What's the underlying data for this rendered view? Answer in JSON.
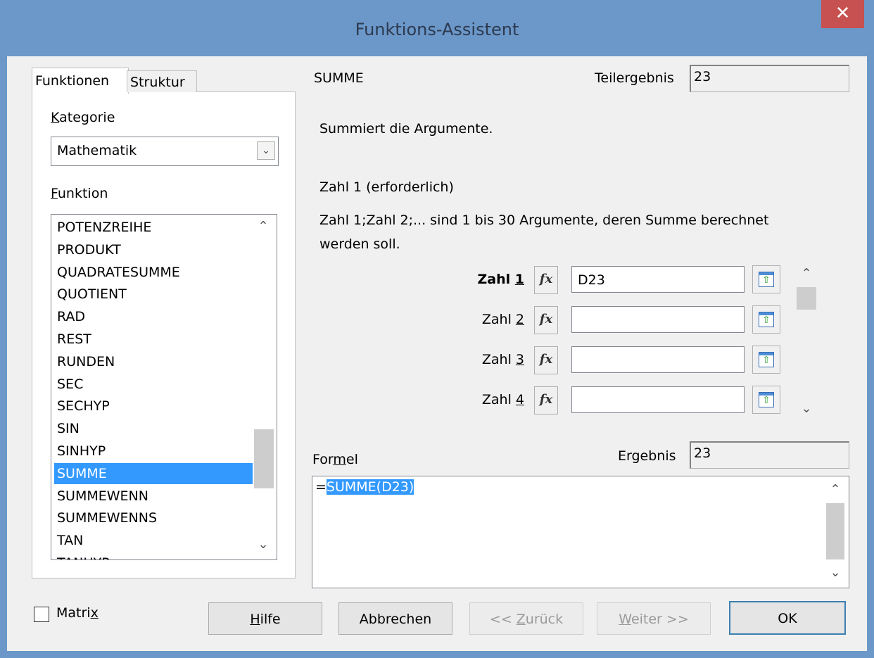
{
  "window": {
    "title": "Funktions-Assistent",
    "close_glyph": "✕"
  },
  "tabs": [
    {
      "label": "Funktionen",
      "active": true
    },
    {
      "label": "Struktur",
      "active": false
    }
  ],
  "category": {
    "label_mnemonic": "K",
    "label_rest": "ategorie",
    "selected": "Mathematik"
  },
  "function": {
    "label_mnemonic": "F",
    "label_rest": "unktion",
    "items": [
      "POTENZREIHE",
      "PRODUKT",
      "QUADRATESUMME",
      "QUOTIENT",
      "RAD",
      "REST",
      "RUNDEN",
      "SEC",
      "SECHYP",
      "SIN",
      "SINHYP",
      "SUMME",
      "SUMMEWENN",
      "SUMMEWENNS",
      "TAN",
      "TANHYP"
    ],
    "selected": "SUMME"
  },
  "detail": {
    "function_name": "SUMME",
    "subtotal_label": "Teilergebnis",
    "subtotal_value": "23",
    "description": "Summiert die Argumente.",
    "argument_title": "Zahl 1 (erforderlich)",
    "argument_help_1": "Zahl 1;Zahl 2;... sind 1 bis 30 Argumente, deren Summe berechnet",
    "argument_help_2": "werden soll."
  },
  "arguments": [
    {
      "label_prefix": "Zahl ",
      "label_digit": "1",
      "value": "D23",
      "bold": true
    },
    {
      "label_prefix": "Zahl ",
      "label_digit": "2",
      "value": "",
      "bold": false
    },
    {
      "label_prefix": "Zahl ",
      "label_digit": "3",
      "value": "",
      "bold": false
    },
    {
      "label_prefix": "Zahl ",
      "label_digit": "4",
      "value": "",
      "bold": false
    }
  ],
  "fx_label": "fx",
  "formula": {
    "label_a": "For",
    "label_mnemonic": "m",
    "label_b": "el",
    "result_label": "Ergebnis",
    "result_value": "23",
    "prefix": "=",
    "highlighted": "SUMME(D23)"
  },
  "matrix": {
    "label_a": "Matri",
    "label_mnemonic": "x",
    "checked": false
  },
  "buttons": {
    "help": {
      "mnemonic": "H",
      "rest": "ilfe"
    },
    "cancel": "Abbrechen",
    "back": {
      "prefix": "<< ",
      "mnemonic": "Z",
      "rest": "urück",
      "enabled": false
    },
    "next": {
      "mnemonic": "W",
      "rest": "eiter >>",
      "enabled": false
    },
    "ok": "OK"
  },
  "colors": {
    "title_bar": "#6b97c9",
    "close_button": "#c75050",
    "selection": "#3399ff",
    "dialog_bg": "#f0f0f0"
  }
}
